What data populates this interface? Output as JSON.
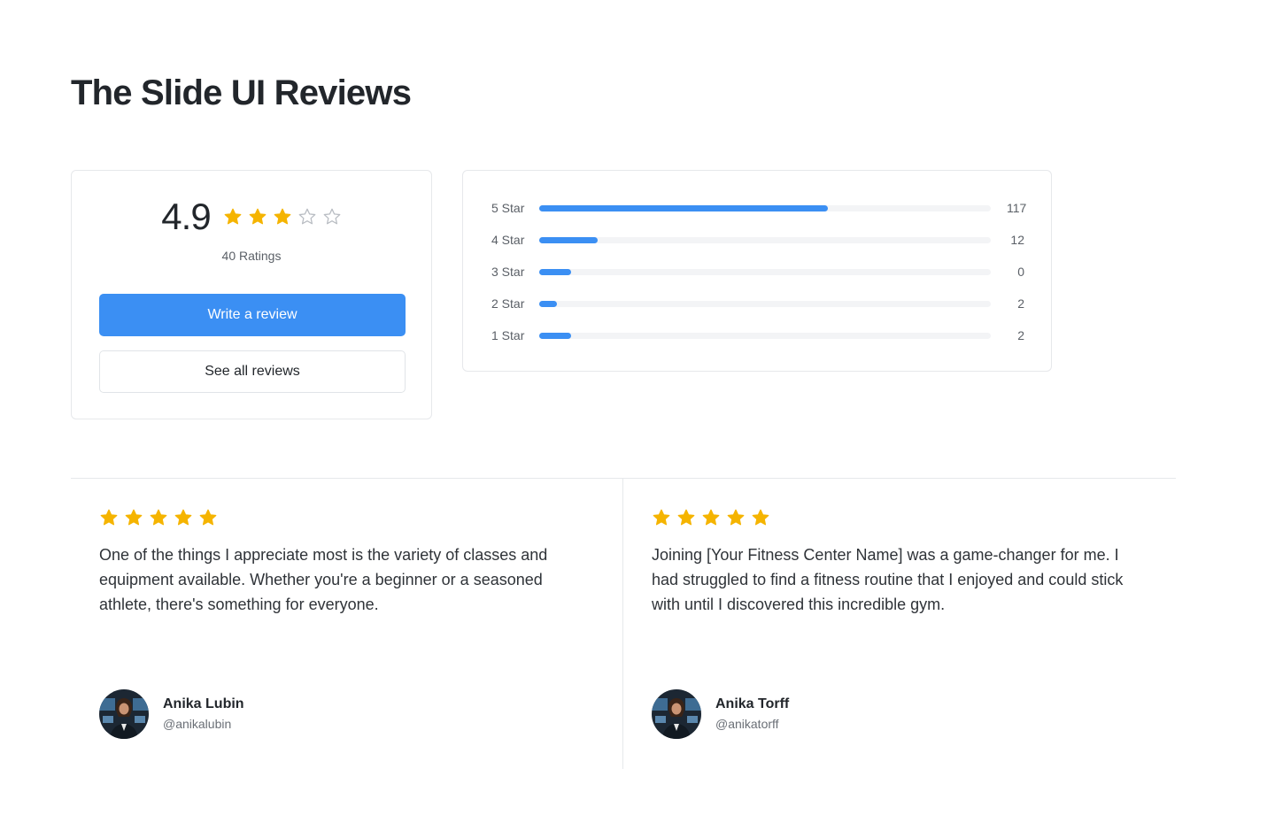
{
  "page": {
    "title": "The Slide UI Reviews"
  },
  "summary": {
    "score": "4.9",
    "score_stars_filled": 3,
    "score_stars_total": 5,
    "ratings_label": "40 Ratings",
    "write_review_label": "Write a review",
    "see_all_label": "See all reviews"
  },
  "distribution": {
    "rows": [
      {
        "label": "5 Star",
        "count": "117",
        "fill_fraction": 0.64
      },
      {
        "label": "4 Star",
        "count": "12",
        "fill_fraction": 0.13
      },
      {
        "label": "3 Star",
        "count": "0",
        "fill_fraction": 0.07
      },
      {
        "label": "2 Star",
        "count": "2",
        "fill_fraction": 0.04
      },
      {
        "label": "1 Star",
        "count": "2",
        "fill_fraction": 0.07
      }
    ]
  },
  "reviews": [
    {
      "stars": 5,
      "text": "One of the things I appreciate most is the variety of classes and equipment available. Whether you're a beginner or a seasoned athlete, there's something for everyone.",
      "name": "Anika Lubin",
      "handle": "@anikalubin"
    },
    {
      "stars": 5,
      "text": "Joining [Your Fitness Center Name] was a game-changer for me. I had struggled to find a fitness routine that I enjoyed and could stick with until I discovered this incredible gym.",
      "name": "Anika Torff",
      "handle": "@anikatorff"
    }
  ],
  "colors": {
    "accent": "#3b8ff3",
    "star_filled": "#f5b400",
    "star_empty": "#b8bcc2",
    "border": "#e6e8eb"
  },
  "icons": {
    "star": "star-icon",
    "star_empty": "star-outline-icon",
    "avatar": "avatar-photo"
  }
}
